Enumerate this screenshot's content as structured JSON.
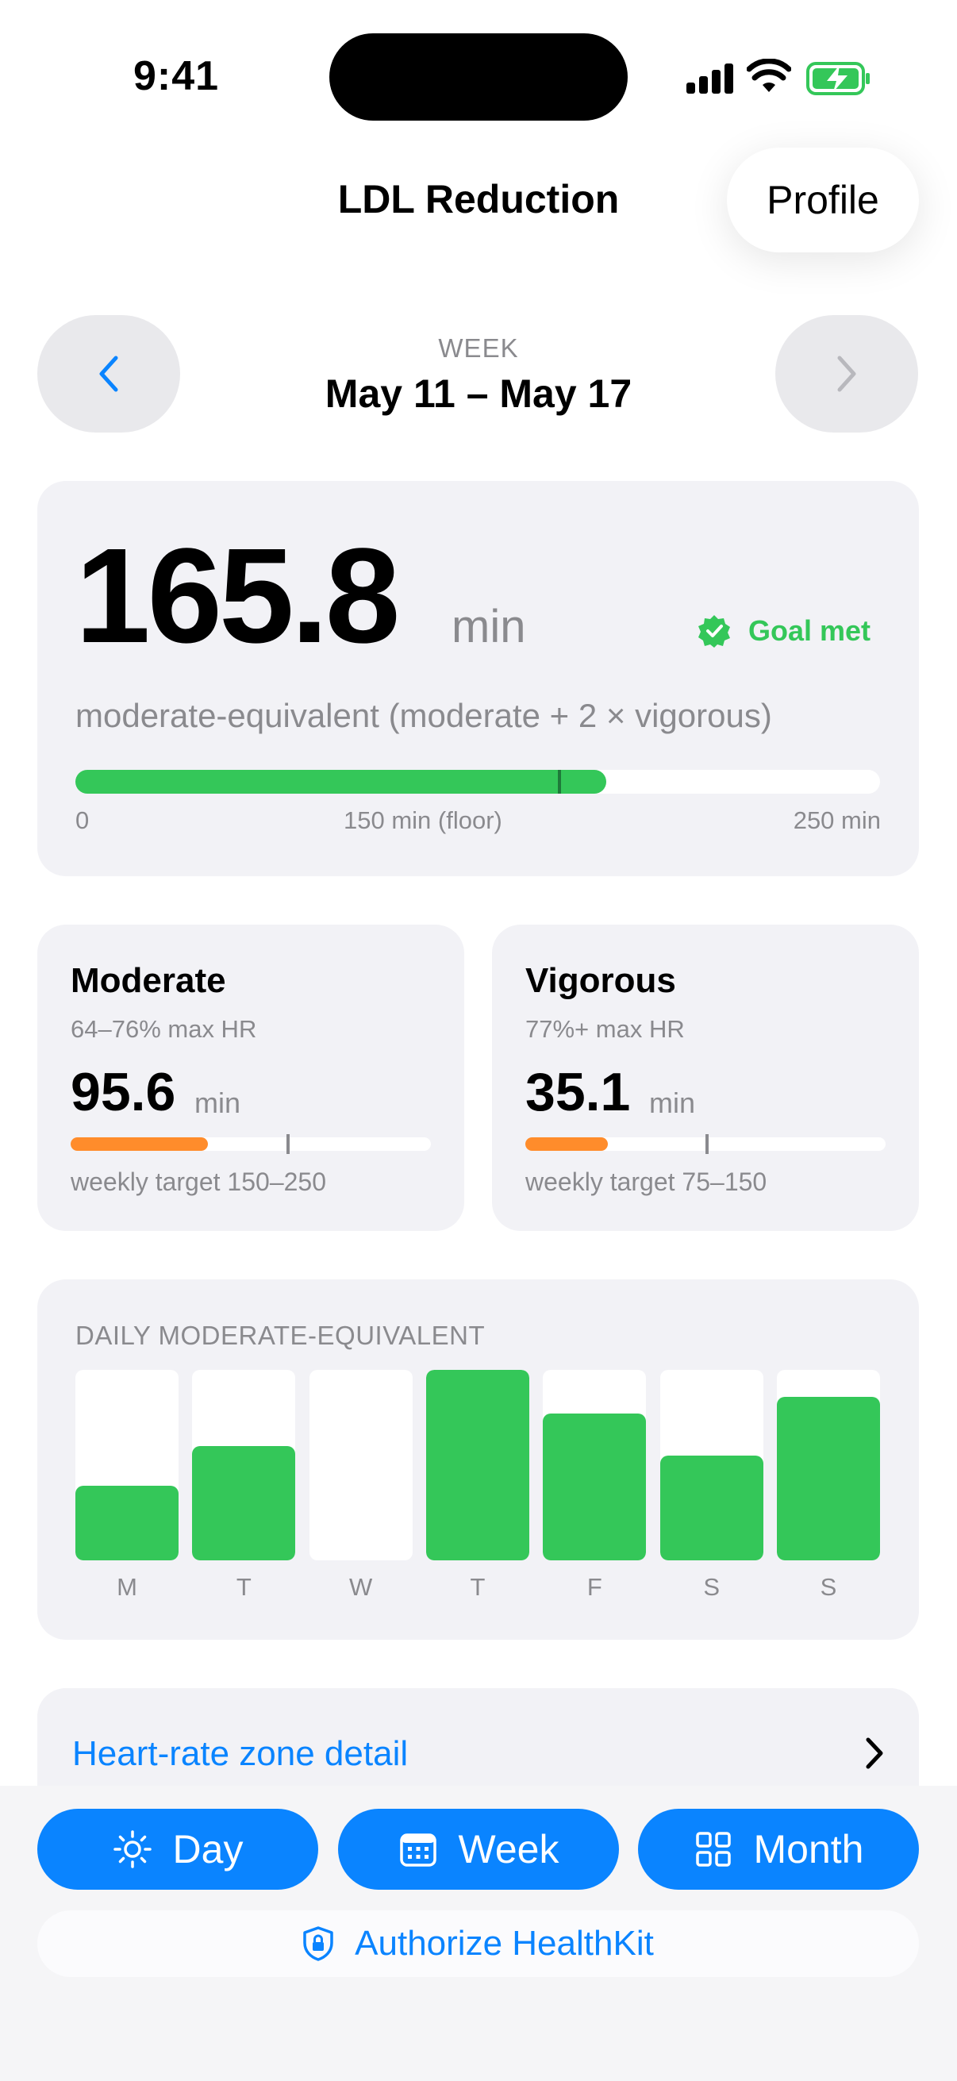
{
  "status_bar": {
    "time": "9:41"
  },
  "nav": {
    "title": "LDL Reduction",
    "profile_label": "Profile"
  },
  "week": {
    "label": "WEEK",
    "range": "May 11 – May 17"
  },
  "summary": {
    "value": "165.8",
    "unit": "min",
    "goal_label": "Goal met",
    "equivalent_label": "moderate-equivalent (moderate + 2 × vigorous)",
    "progress_fraction": 0.66,
    "floor_marker_fraction": 0.6,
    "scale": {
      "min": "0",
      "floor": "150 min (floor)",
      "max": "250 min"
    }
  },
  "moderate": {
    "title": "Moderate",
    "subtitle": "64–76% max HR",
    "value": "95.6",
    "unit": "min",
    "progress_fraction": 0.38,
    "target_marker_fraction": 0.6,
    "target": "weekly target 150–250"
  },
  "vigorous": {
    "title": "Vigorous",
    "subtitle": "77%+ max HR",
    "value": "35.1",
    "unit": "min",
    "progress_fraction": 0.23,
    "target_marker_fraction": 0.5,
    "target": "weekly target 75–150"
  },
  "daily": {
    "title": "DAILY MODERATE-EQUIVALENT",
    "days": [
      {
        "label": "M",
        "fraction": 0.39
      },
      {
        "label": "T",
        "fraction": 0.6
      },
      {
        "label": "W",
        "fraction": 0.0
      },
      {
        "label": "T",
        "fraction": 1.0
      },
      {
        "label": "F",
        "fraction": 0.77
      },
      {
        "label": "S",
        "fraction": 0.55
      },
      {
        "label": "S",
        "fraction": 0.86
      }
    ]
  },
  "detail": {
    "label": "Heart-rate zone detail"
  },
  "tabs": {
    "day": "Day",
    "week": "Week",
    "month": "Month"
  },
  "authorize": {
    "label": "Authorize HealthKit"
  },
  "colors": {
    "accent": "#0a84ff",
    "success": "#34c759",
    "warning": "#ff8c2b"
  }
}
